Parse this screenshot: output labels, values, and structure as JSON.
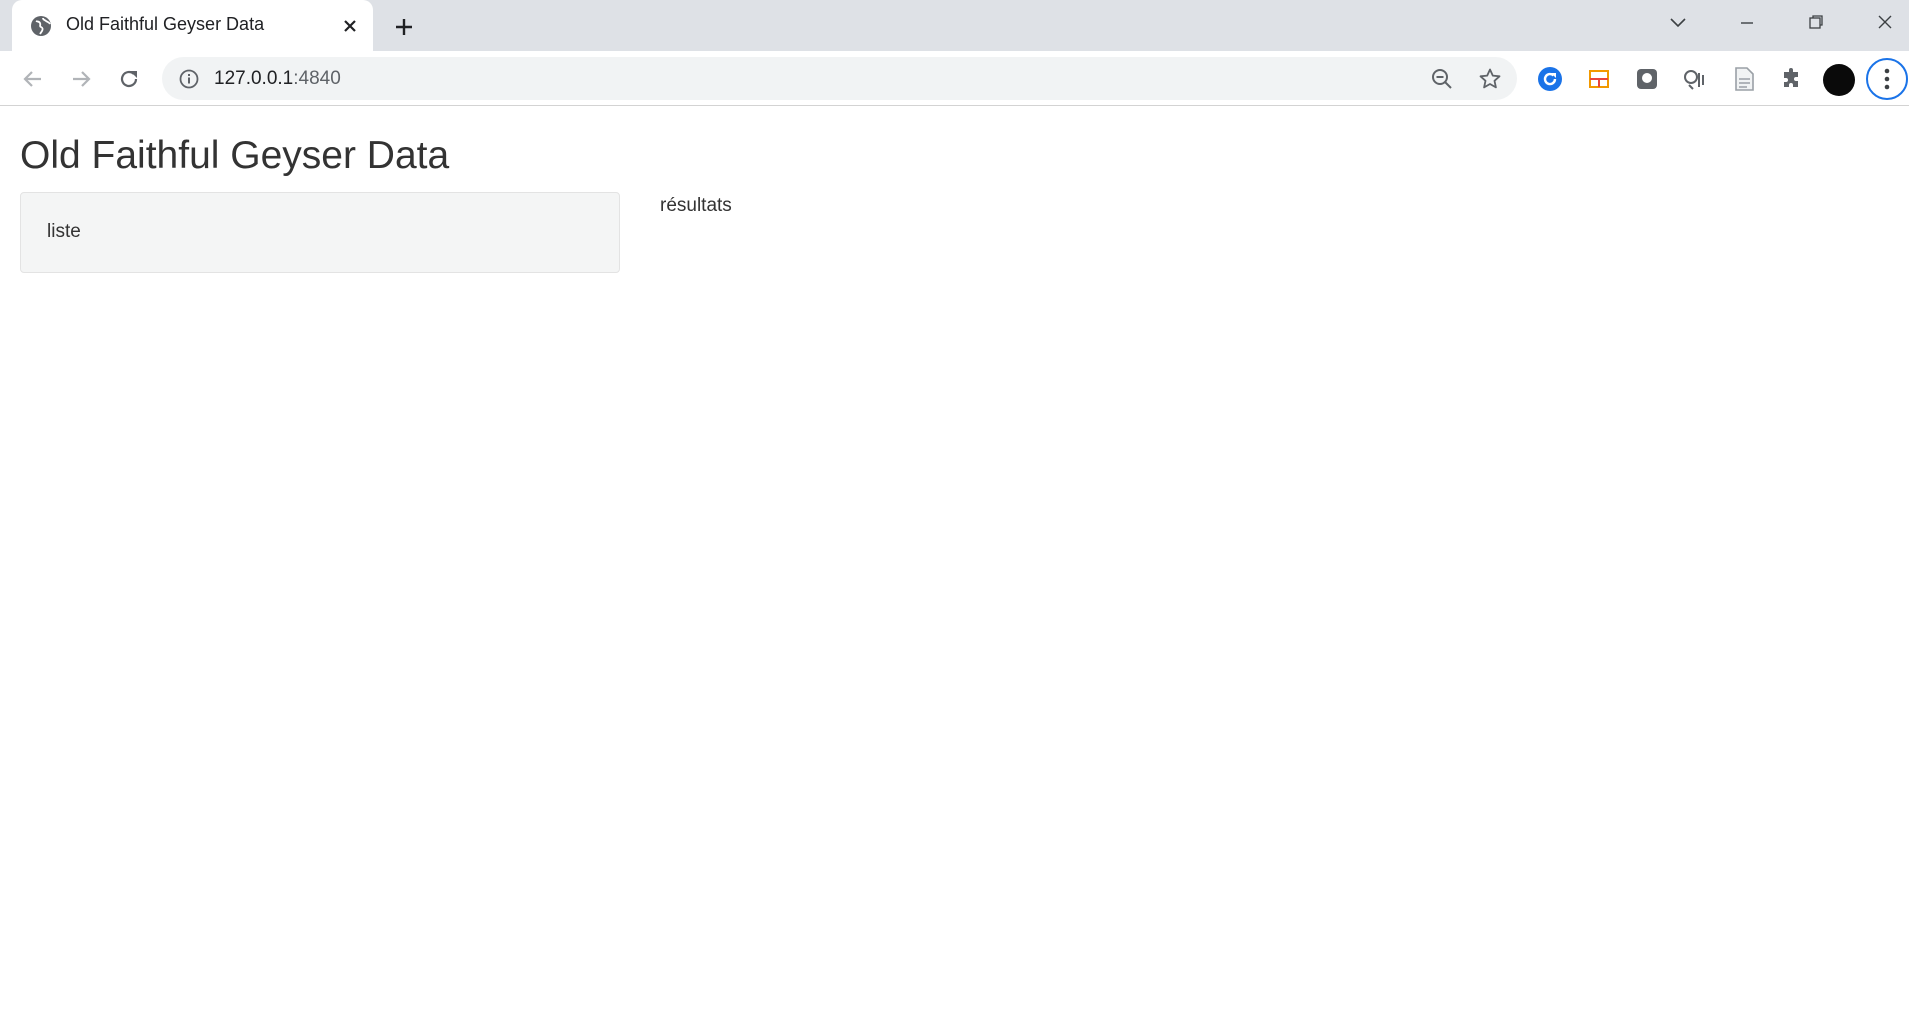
{
  "browser": {
    "tab": {
      "title": "Old Faithful Geyser Data",
      "favicon": "globe-icon"
    },
    "address": {
      "host": "127.0.0.1",
      "port": ":4840"
    },
    "colors": {
      "accent": "#1a73e8",
      "tabstrip": "#dee1e6",
      "omnibox": "#f1f3f4"
    }
  },
  "page": {
    "title": "Old Faithful Geyser Data",
    "sidebar": {
      "label": "liste"
    },
    "main": {
      "label": "résultats"
    }
  }
}
